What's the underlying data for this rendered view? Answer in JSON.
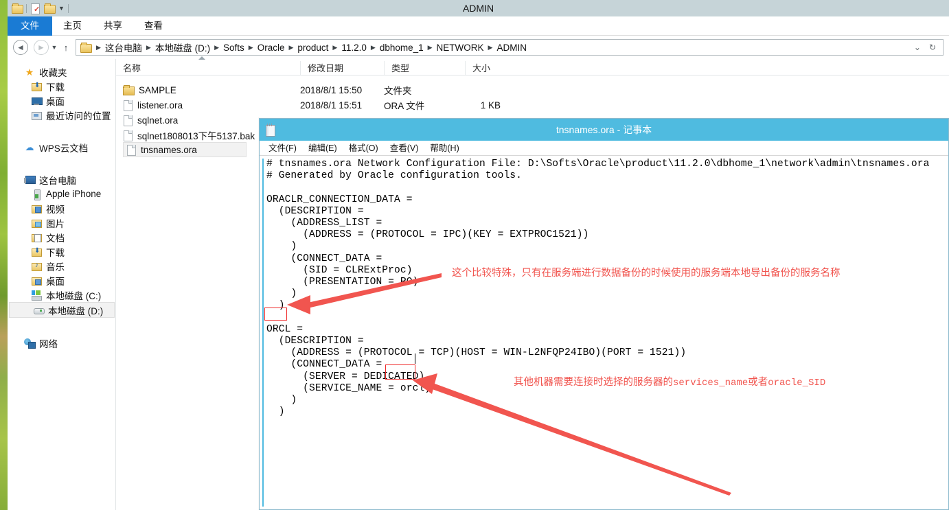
{
  "explorer": {
    "title": "ADMIN",
    "quick_access": [
      "folder-icon",
      "separator",
      "new-folder-properties-icon",
      "folder-icon",
      "chevron-down-icon"
    ],
    "ribbon_tabs": [
      {
        "label": "文件",
        "active": true
      },
      {
        "label": "主页",
        "active": false
      },
      {
        "label": "共享",
        "active": false
      },
      {
        "label": "查看",
        "active": false
      }
    ],
    "nav": {
      "back": "◄",
      "forward": "►",
      "history_caret": "▼",
      "up": "↑",
      "dropdown_caret": "⌄",
      "refresh": "↻"
    },
    "breadcrumb": [
      "这台电脑",
      "本地磁盘 (D:)",
      "Softs",
      "Oracle",
      "product",
      "11.2.0",
      "dbhome_1",
      "NETWORK",
      "ADMIN"
    ],
    "nav_pane": [
      {
        "label": "收藏夹",
        "icon": "star-icon",
        "level": 0
      },
      {
        "label": "下载",
        "icon": "download-folder-icon",
        "level": 1
      },
      {
        "label": "桌面",
        "icon": "desktop-icon",
        "level": 1
      },
      {
        "label": "最近访问的位置",
        "icon": "recent-places-icon",
        "level": 1
      },
      {
        "label": "__GAP__",
        "icon": "",
        "level": 0
      },
      {
        "label": "WPS云文档",
        "icon": "cloud-icon",
        "level": 0
      },
      {
        "label": "__GAP__",
        "icon": "",
        "level": 0
      },
      {
        "label": "这台电脑",
        "icon": "this-pc-icon",
        "level": 0
      },
      {
        "label": "Apple iPhone",
        "icon": "phone-icon",
        "level": 1
      },
      {
        "label": "视频",
        "icon": "videos-folder-icon",
        "level": 1
      },
      {
        "label": "图片",
        "icon": "pictures-folder-icon",
        "level": 1
      },
      {
        "label": "文档",
        "icon": "documents-folder-icon",
        "level": 1
      },
      {
        "label": "下载",
        "icon": "download-folder-icon",
        "level": 1
      },
      {
        "label": "音乐",
        "icon": "music-folder-icon",
        "level": 1
      },
      {
        "label": "桌面",
        "icon": "desktop-folder-icon",
        "level": 1
      },
      {
        "label": "本地磁盘 (C:)",
        "icon": "hard-drive-c-icon",
        "level": 1
      },
      {
        "label": "本地磁盘 (D:)",
        "icon": "hard-drive-d-icon",
        "level": 1,
        "selected": true
      },
      {
        "label": "__GAP__",
        "icon": "",
        "level": 0
      },
      {
        "label": "网络",
        "icon": "network-icon",
        "level": 0
      }
    ],
    "columns": [
      {
        "key": "name",
        "label": "名称",
        "sorted": "asc"
      },
      {
        "key": "date",
        "label": "修改日期"
      },
      {
        "key": "type",
        "label": "类型"
      },
      {
        "key": "size",
        "label": "大小"
      }
    ],
    "files": [
      {
        "name": "SAMPLE",
        "date": "2018/8/1 15:50",
        "type": "文件夹",
        "size": "",
        "icon": "folder-icon",
        "selected": false
      },
      {
        "name": "listener.ora",
        "date": "2018/8/1 15:51",
        "type": "ORA 文件",
        "size": "1 KB",
        "icon": "file-icon",
        "selected": false
      },
      {
        "name": "sqlnet.ora",
        "date": "",
        "type": "",
        "size": "",
        "icon": "file-icon",
        "selected": false
      },
      {
        "name": "sqlnet1808013下午5137.bak",
        "date": "",
        "type": "",
        "size": "",
        "icon": "file-icon",
        "selected": false
      },
      {
        "name": "tnsnames.ora",
        "date": "",
        "type": "",
        "size": "",
        "icon": "file-icon",
        "selected": true
      }
    ]
  },
  "notepad": {
    "title": "tnsnames.ora - 记事本",
    "icon": "notepad-icon",
    "menu": [
      "文件(F)",
      "编辑(E)",
      "格式(O)",
      "查看(V)",
      "帮助(H)"
    ],
    "content": "# tnsnames.ora Network Configuration File: D:\\Softs\\Oracle\\product\\11.2.0\\dbhome_1\\network\\admin\\tnsnames.ora\n# Generated by Oracle configuration tools.\n\nORACLR_CONNECTION_DATA =\n  (DESCRIPTION =\n    (ADDRESS_LIST =\n      (ADDRESS = (PROTOCOL = IPC)(KEY = EXTPROC1521))\n    )\n    (CONNECT_DATA =\n      (SID = CLRExtProc)\n      (PRESENTATION = RO)\n    )\n  )\n\nORCL =\n  (DESCRIPTION =\n    (ADDRESS = (PROTOCOL = TCP)(HOST = WIN-L2NFQP24IBO)(PORT = 1521))\n    (CONNECT_DATA =\n      (SERVER = DEDICATED)\n      (SERVICE_NAME = orcl)\n    )\n  )\n"
  },
  "annotations": {
    "color": "#f1554f",
    "items": [
      {
        "name": "orclr-note",
        "text": "这个比较特殊，只有在服务端进行数据备份的时候使用的服务端本地导出备份的服务名称",
        "target": "ORCL"
      },
      {
        "name": "service-name-note",
        "text_prefix": "其他机器需要连接时选择的服务器的",
        "text_mono1": "services_name",
        "text_mid": "或者",
        "text_mono2": "oracle_SID",
        "target": "orcl"
      }
    ],
    "highlight_boxes": [
      {
        "name": "orcl-keyword-box",
        "label": "ORCL"
      },
      {
        "name": "orcl-value-box",
        "label": "orcl)"
      }
    ]
  },
  "colors": {
    "explorer_titlebar": "#c6d4d8",
    "ribbon_file_tab": "#1a7bd4",
    "notepad_titlebar": "#4fbbe0",
    "annotation_red": "#f1554f",
    "highlight_border": "#ef2b2b",
    "selection_bg": "#f2f2f2"
  }
}
